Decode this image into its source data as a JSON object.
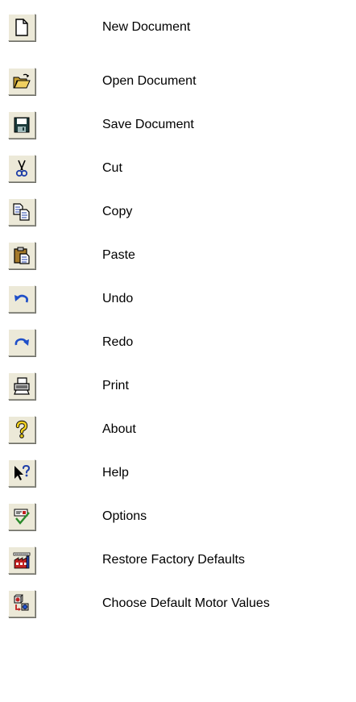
{
  "toolbar_legend": {
    "items": [
      {
        "icon": "new-document-icon",
        "label": "New Document"
      },
      {
        "icon": "open-folder-icon",
        "label": "Open Document"
      },
      {
        "icon": "floppy-disk-icon",
        "label": "Save Document"
      },
      {
        "icon": "scissors-icon",
        "label": "Cut"
      },
      {
        "icon": "copy-icon",
        "label": "Copy"
      },
      {
        "icon": "clipboard-icon",
        "label": "Paste"
      },
      {
        "icon": "undo-arrow-icon",
        "label": "Undo"
      },
      {
        "icon": "redo-arrow-icon",
        "label": "Redo"
      },
      {
        "icon": "printer-icon",
        "label": "Print"
      },
      {
        "icon": "question-mark-icon",
        "label": "About"
      },
      {
        "icon": "context-help-icon",
        "label": "Help"
      },
      {
        "icon": "options-checkmark-icon",
        "label": "Options"
      },
      {
        "icon": "factory-icon",
        "label": "Restore Factory Defaults"
      },
      {
        "icon": "motor-values-icon",
        "label": "Choose Default Motor Values"
      }
    ]
  },
  "colors": {
    "button_face": "#ece9d8",
    "icon_yellow": "#e8c53a",
    "icon_blue": "#1f4fc8",
    "icon_red": "#c02020",
    "text": "#000000"
  }
}
